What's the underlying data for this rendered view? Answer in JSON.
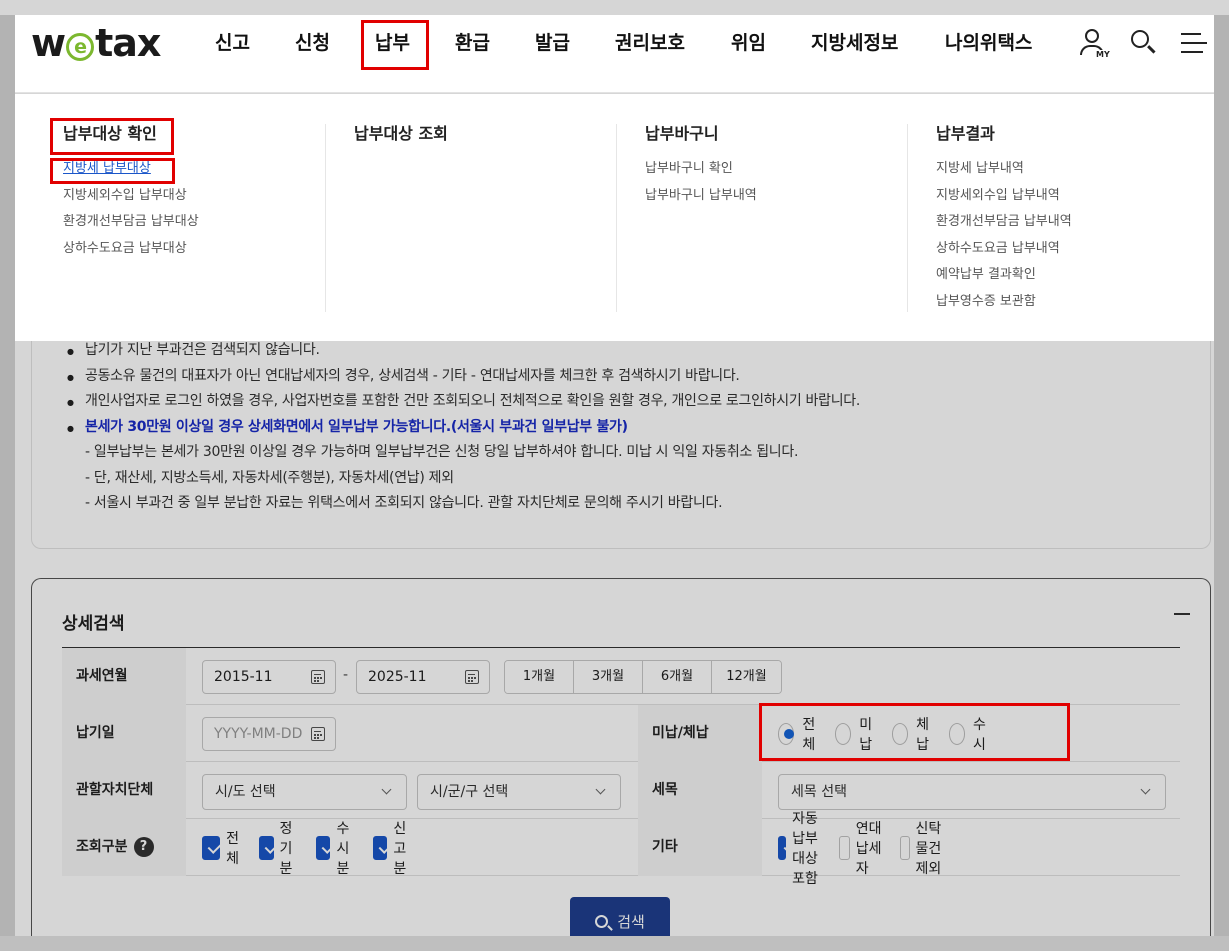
{
  "logo": {
    "text_pre": "w",
    "text_e": "e",
    "text_post": "tax"
  },
  "nav": {
    "items": [
      "신고",
      "신청",
      "납부",
      "환급",
      "발급",
      "권리보호",
      "위임",
      "지방세정보",
      "나의위택스"
    ],
    "active": "납부"
  },
  "header_icons": {
    "user": "user-icon",
    "user_badge": "MY",
    "search": "search-icon",
    "menu": "menu-icon"
  },
  "mega_menu": {
    "columns": [
      {
        "title": "납부대상 확인",
        "links": [
          "지방세 납부대상",
          "지방세외수입 납부대상",
          "환경개선부담금 납부대상",
          "상하수도요금 납부대상"
        ]
      },
      {
        "title": "납부대상 조회",
        "links": []
      },
      {
        "title": "납부바구니",
        "links": [
          "납부바구니 확인",
          "납부바구니 납부내역"
        ]
      },
      {
        "title": "납부결과",
        "links": [
          "지방세 납부내역",
          "지방세외수입 납부내역",
          "환경개선부담금 납부내역",
          "상하수도요금 납부내역",
          "예약납부 결과확인",
          "납부영수증 보관함"
        ]
      }
    ]
  },
  "notice": {
    "items": [
      "납기가 지난 부과건은 검색되지 않습니다.",
      "공동소유 물건의 대표자가 아닌 연대납세자의 경우, 상세검색 - 기타 - 연대납세자를 체크한 후 검색하시기 바랍니다.",
      "개인사업자로 로그인 하였을 경우, 사업자번호를 포함한 건만 조회되오니 전체적으로 확인을 원할 경우, 개인으로 로그인하시기 바랍니다.",
      "본세가 30만원 이상일 경우 상세화면에서 일부납부 가능합니다.(서울시 부과건 일부납부 불가)"
    ],
    "subitems": [
      "- 일부납부는 본세가 30만원 이상일 경우 가능하며 일부납부건은 신청 당일 납부하셔야 합니다. 미납 시 익일 자동취소 됩니다.",
      "- 단, 재산세, 지방소득세, 자동차세(주행분), 자동차세(연납) 제외",
      "- 서울시 부과건 중 일부 분납한 자료는 위택스에서 조회되지 않습니다. 관할 자치단체로 문의해 주시기 바랍니다."
    ]
  },
  "search": {
    "title": "상세검색",
    "collapse_icon": "minus-icon",
    "rows": {
      "period_label": "과세연월",
      "period_from": "2015-11",
      "period_to": "2025-11",
      "period_sep": "-",
      "period_buttons": [
        "1개월",
        "3개월",
        "6개월",
        "12개월"
      ],
      "due_label": "납기일",
      "due_placeholder": "YYYY-MM-DD",
      "status_label": "미납/체납",
      "status_options": [
        "전체",
        "미납",
        "체납",
        "수시"
      ],
      "status_selected": "전체",
      "region_label": "관할자치단체",
      "region_sido": "시/도 선택",
      "region_sigungu": "시/군/구 선택",
      "tax_label": "세목",
      "tax_select": "세목 선택",
      "type_label": "조회구분",
      "type_help": "?",
      "type_options": [
        "전체",
        "정기분",
        "수시분",
        "신고분"
      ],
      "etc_label": "기타",
      "etc_options": [
        "자동납부대상포함",
        "연대납세자",
        "신탁물건제외"
      ],
      "etc_checked": [
        "자동납부대상포함"
      ]
    },
    "submit_label": "검색"
  },
  "colors": {
    "brand_green": "#7cb82f",
    "highlight_red": "#e10000",
    "primary_blue": "#1a56c9",
    "button_navy": "#1f3f8f",
    "notice_blue": "#1a2bc8"
  }
}
